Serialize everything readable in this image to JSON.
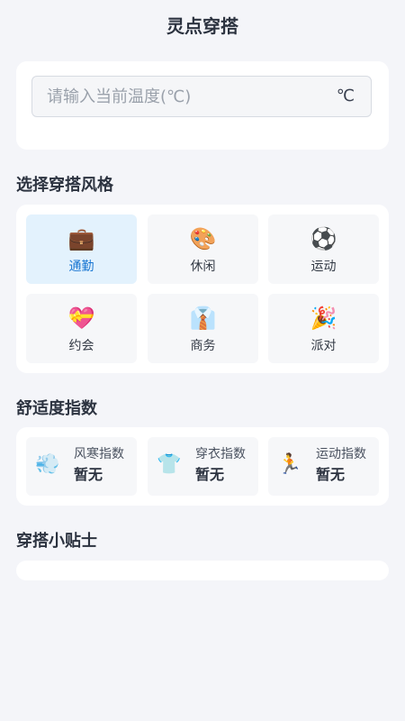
{
  "app": {
    "title": "灵点穿搭"
  },
  "temperature": {
    "placeholder": "请输入当前温度(℃)",
    "value": "",
    "unit": "℃"
  },
  "styles": {
    "heading": "选择穿搭风格",
    "items": [
      {
        "label": "通勤",
        "icon": "briefcase-icon",
        "glyph": "💼",
        "selected": true
      },
      {
        "label": "休闲",
        "icon": "palette-icon",
        "glyph": "🎨",
        "selected": false
      },
      {
        "label": "运动",
        "icon": "soccer-ball-icon",
        "glyph": "⚽",
        "selected": false
      },
      {
        "label": "约会",
        "icon": "heart-gift-icon",
        "glyph": "💝",
        "selected": false
      },
      {
        "label": "商务",
        "icon": "shirt-tie-icon",
        "glyph": "👔",
        "selected": false
      },
      {
        "label": "派对",
        "icon": "party-popper-icon",
        "glyph": "🎉",
        "selected": false
      }
    ]
  },
  "comfort": {
    "heading": "舒适度指数",
    "items": [
      {
        "name": "风寒指数",
        "value": "暂无",
        "icon": "wind-icon",
        "glyph": "💨"
      },
      {
        "name": "穿衣指数",
        "value": "暂无",
        "icon": "t-shirt-icon",
        "glyph": "👕"
      },
      {
        "name": "运动指数",
        "value": "暂无",
        "icon": "runner-icon",
        "glyph": "🏃"
      }
    ]
  },
  "tips": {
    "heading": "穿搭小贴士"
  },
  "colors": {
    "accent": "#1976d2",
    "selected_bg": "#e3f2fd",
    "background": "#f4f5f9"
  }
}
